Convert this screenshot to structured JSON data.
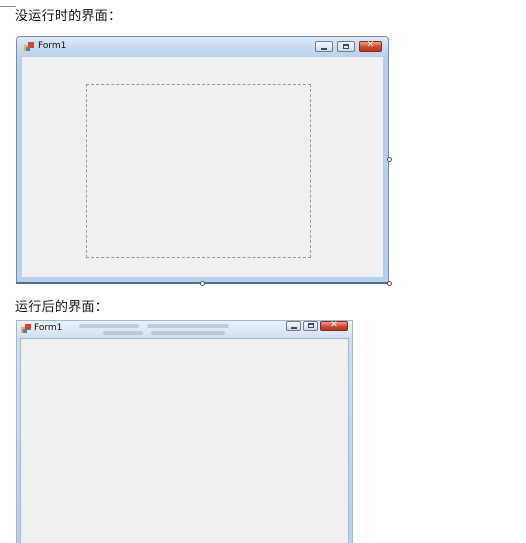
{
  "captions": {
    "before_run": "没运行时的界面：",
    "after_run": "运行后的界面："
  },
  "designer_window": {
    "title": "Form1",
    "icon": "form-app-icon",
    "buttons": [
      "minimize-icon",
      "maximize-icon",
      "close-icon"
    ]
  },
  "running_window": {
    "title": "Form1",
    "icon": "form-app-icon",
    "buttons": [
      "minimize-icon",
      "maximize-icon",
      "close-icon"
    ]
  },
  "colors": {
    "form_background": "#f0f0f0",
    "title_bar": "#c8daef",
    "close_button": "#c8442b",
    "frame": "#b8d0ea"
  }
}
